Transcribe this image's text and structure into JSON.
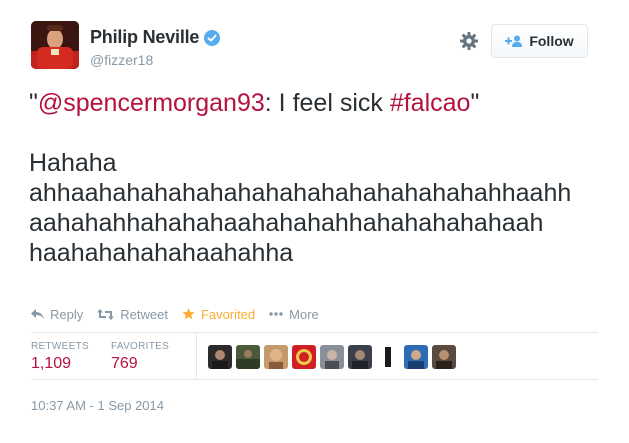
{
  "user": {
    "display_name": "Philip Neville",
    "handle": "@fizzer18",
    "verified": true
  },
  "follow_button": {
    "label": "Follow"
  },
  "tweet": {
    "quote_open": "\"",
    "mention": "@spencermorgan93",
    "text_middle": ": I feel sick ",
    "hashtag": "#falcao",
    "quote_close": "\"",
    "lines": [
      "Hahaha",
      "ahhaahahahahahahahahahahahahahahahhaahh",
      "aahahahhahahahaahahahahhahahahahahaah",
      "haahahahahahaahahha"
    ]
  },
  "actions": {
    "reply": "Reply",
    "retweet": "Retweet",
    "favorited": "Favorited",
    "more": "More"
  },
  "stats": {
    "retweets_label": "RETWEETS",
    "retweets_value": "1,109",
    "favorites_label": "FAVORITES",
    "favorites_value": "769"
  },
  "timestamp": "10:37 AM - 1 Sep 2014",
  "colors": {
    "link": "#b5123e",
    "favorited": "#ffac33",
    "verified": "#55acee",
    "muted": "#8899a6"
  },
  "favoriter_avatars": [
    "avatar-1",
    "avatar-2",
    "avatar-3",
    "avatar-4",
    "avatar-5",
    "avatar-6",
    "avatar-7",
    "avatar-8",
    "avatar-9"
  ]
}
